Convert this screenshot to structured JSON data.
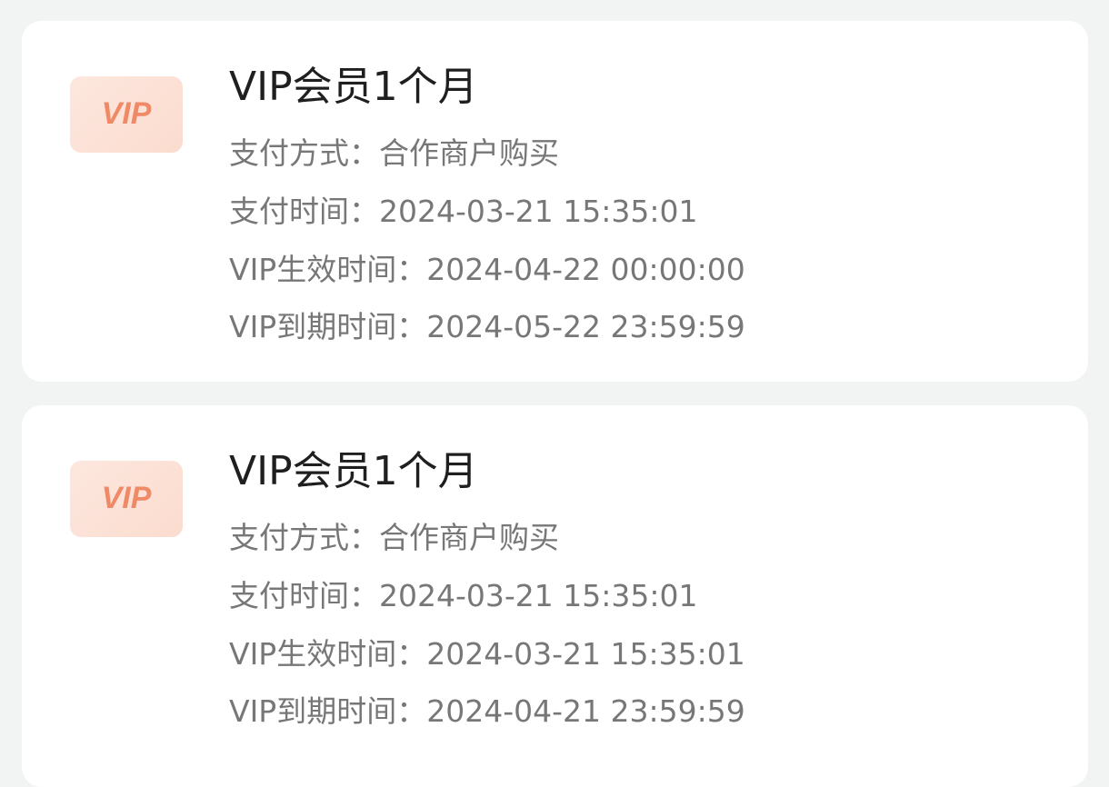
{
  "badge_colors": {
    "background": "#fbe0d5",
    "text": "#f08a66"
  },
  "records": [
    {
      "badge_text": "VIP",
      "title": "VIP会员1个月",
      "pay_method_label": "支付方式：",
      "pay_method": "合作商户购买",
      "pay_time_label": "支付时间：",
      "pay_time": "2024-03-21 15:35:01",
      "effective_label": "VIP生效时间：",
      "effective_time": "2024-04-22 00:00:00",
      "expire_label": "VIP到期时间：",
      "expire_time": "2024-05-22 23:59:59"
    },
    {
      "badge_text": "VIP",
      "title": "VIP会员1个月",
      "pay_method_label": "支付方式：",
      "pay_method": "合作商户购买",
      "pay_time_label": "支付时间：",
      "pay_time": "2024-03-21 15:35:01",
      "effective_label": "VIP生效时间：",
      "effective_time": "2024-03-21 15:35:01",
      "expire_label": "VIP到期时间：",
      "expire_time": "2024-04-21 23:59:59"
    }
  ]
}
